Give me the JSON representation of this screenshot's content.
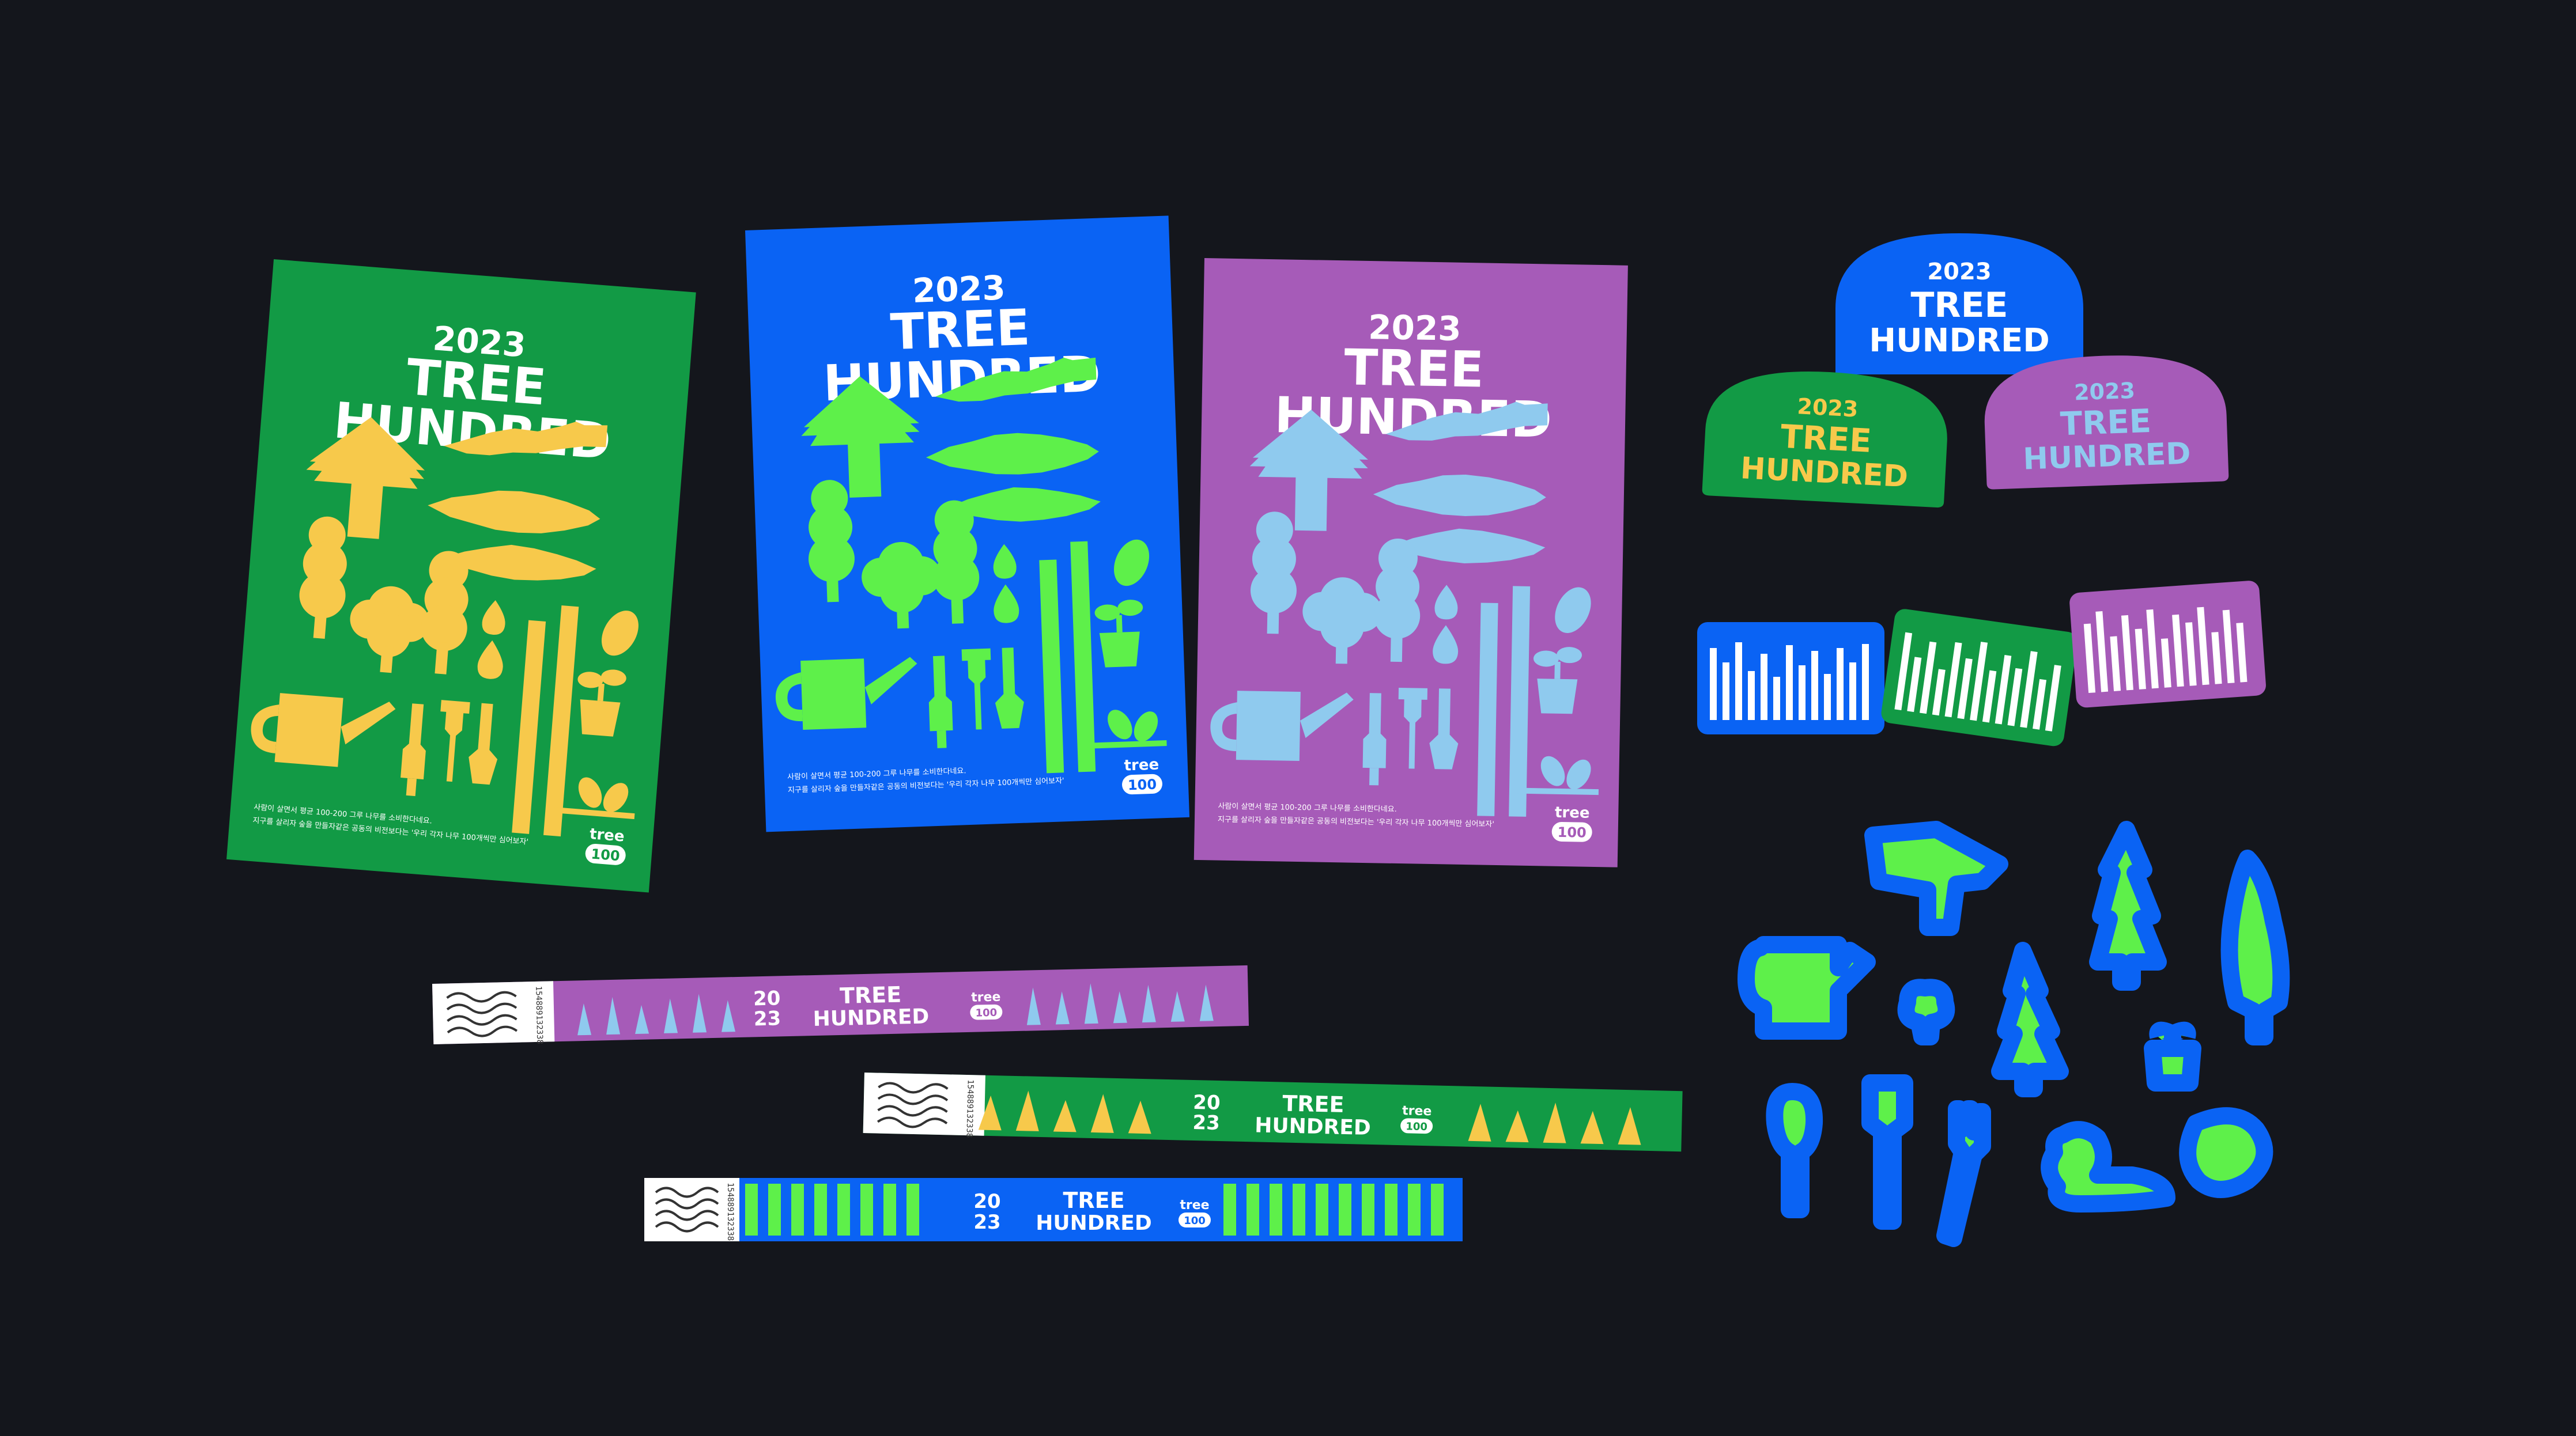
{
  "posters": [
    {
      "id": "green",
      "year": "2023",
      "title_line1": "TREE",
      "title_line2": "HUNDRED",
      "logo_word": "tree",
      "logo_num": "100",
      "body_line1": "사람이 살면서 평균 100-200 그루 나무를 소비한다네요.",
      "body_line2": "지구를 살리자 숲을 만들자같은 공동의 비전보다는 '우리 각자 나무 100개씩만 심어보자'",
      "bg": "#129a45",
      "fg": "#f7c94b"
    },
    {
      "id": "blue",
      "year": "2023",
      "title_line1": "TREE",
      "title_line2": "HUNDRED",
      "logo_word": "tree",
      "logo_num": "100",
      "body_line1": "사람이 살면서 평균 100-200 그루 나무를 소비한다네요.",
      "body_line2": "지구를 살리자 숲을 만들자같은 공동의 비전보다는 '우리 각자 나무 100개씩만 심어보자'",
      "bg": "#0a63f4",
      "fg": "#5ef04a"
    },
    {
      "id": "purple",
      "year": "2023",
      "title_line1": "TREE",
      "title_line2": "HUNDRED",
      "logo_word": "tree",
      "logo_num": "100",
      "body_line1": "사람이 살면서 평균 100-200 그루 나무를 소비한다네요.",
      "body_line2": "지구를 살리자 숲을 만들자같은 공동의 비전보다는 '우리 각자 나무 100개씩만 심어보자'",
      "bg": "#a65bb8",
      "fg": "#8fcaee"
    }
  ],
  "badges": [
    {
      "id": "blue",
      "year": "2023",
      "line1": "TREE",
      "line2": "HUNDRED",
      "bg": "#0a63f4",
      "fg": "#ffffff"
    },
    {
      "id": "green",
      "year": "2023",
      "line1": "TREE",
      "line2": "HUNDRED",
      "bg": "#129a45",
      "fg": "#f7c94b"
    },
    {
      "id": "purple",
      "year": "2023",
      "line1": "TREE",
      "line2": "HUNDRED",
      "bg": "#a65bb8",
      "fg": "#8fcaee"
    }
  ],
  "bar_stickers": [
    {
      "id": "blue",
      "bg": "#0a63f4"
    },
    {
      "id": "green",
      "bg": "#129a45"
    },
    {
      "id": "purple",
      "bg": "#a65bb8"
    }
  ],
  "wristbands": [
    {
      "id": "purple",
      "serial": "154889132338",
      "year_a": "20",
      "year_b": "23",
      "line1": "TREE",
      "line2": "HUNDRED",
      "logo_word": "tree",
      "logo_num": "100",
      "bg": "#a65bb8",
      "fg": "#8fcaee"
    },
    {
      "id": "green",
      "serial": "154889132338",
      "year_a": "20",
      "year_b": "23",
      "line1": "TREE",
      "line2": "HUNDRED",
      "logo_word": "tree",
      "logo_num": "100",
      "bg": "#129a45",
      "fg": "#f7c94b"
    },
    {
      "id": "blue",
      "serial": "154889132338",
      "year_a": "20",
      "year_b": "23",
      "line1": "TREE",
      "line2": "HUNDRED",
      "logo_word": "tree",
      "logo_num": "100",
      "bg": "#0a63f4",
      "fg": "#5ef04a"
    }
  ],
  "stickers": {
    "fill": "#5ef04a",
    "outline": "#0a63f4",
    "icons": [
      "house-tree-icon",
      "watering-can-icon",
      "small-tree-icon",
      "pine-tree-icon",
      "tall-pine-icon",
      "cypress-icon",
      "seedling-pot-icon",
      "shovel-icon",
      "spade-icon",
      "fork-icon",
      "bush-icon"
    ]
  },
  "background_color": "#14161c"
}
